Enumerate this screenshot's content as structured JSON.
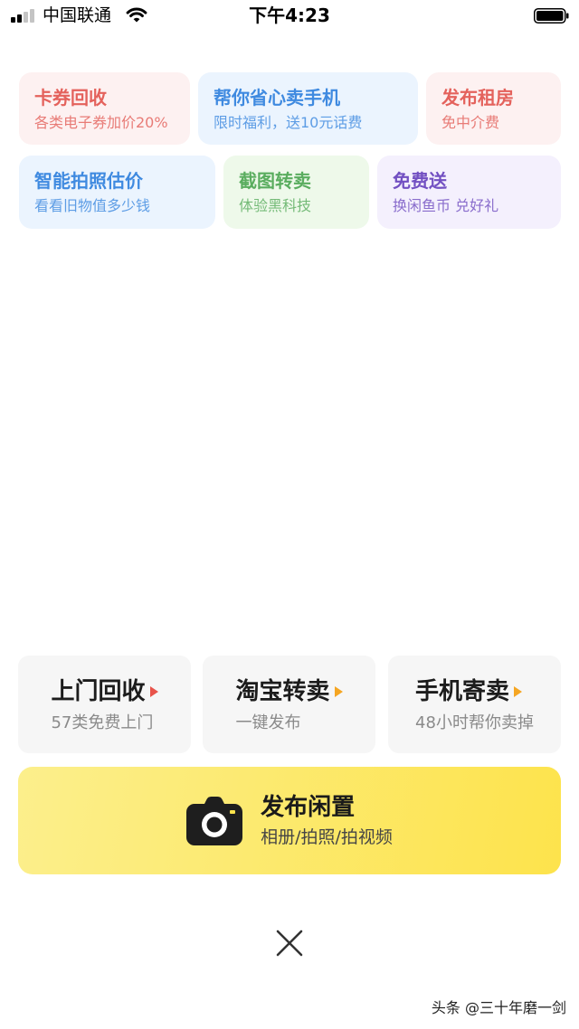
{
  "status_bar": {
    "carrier": "中国联通",
    "time": "下午4:23",
    "icons": {
      "signal": "signal-icon",
      "wifi": "wifi-icon",
      "battery": "battery-icon"
    }
  },
  "quick_actions": [
    {
      "title": "卡券回收",
      "subtitle": "各类电子券加价20%",
      "accent": "#e4625c",
      "bg": "#fdf1f1"
    },
    {
      "title": "帮你省心卖手机",
      "subtitle": "限时福利，送10元话费",
      "accent": "#3f8ae0",
      "bg": "#ebf4fe"
    },
    {
      "title": "发布租房",
      "subtitle": "免中介费",
      "accent": "#e4625c",
      "bg": "#fdf1f1"
    },
    {
      "title": "智能拍照估价",
      "subtitle": "看看旧物值多少钱",
      "accent": "#3f8ae0",
      "bg": "#ebf4fe"
    },
    {
      "title": "截图转卖",
      "subtitle": "体验黑科技",
      "accent": "#5aad5f",
      "bg": "#eef9ea"
    },
    {
      "title": "免费送",
      "subtitle": "换闲鱼币 兑好礼",
      "accent": "#7250c2",
      "bg": "#f4f0fd"
    }
  ],
  "services": [
    {
      "title": "上门回收",
      "subtitle": "57类免费上门",
      "arrow_color": "#e8534a"
    },
    {
      "title": "淘宝转卖",
      "subtitle": "一键发布",
      "arrow_color": "#f5a623"
    },
    {
      "title": "手机寄卖",
      "subtitle": "48小时帮你卖掉",
      "arrow_color": "#f5a623"
    }
  ],
  "publish": {
    "title": "发布闲置",
    "subtitle": "相册/拍照/拍视频",
    "icon": "camera-icon",
    "gradient": [
      "#fcef8c",
      "#fde34c"
    ]
  },
  "close": {
    "icon": "close-icon"
  },
  "watermark": "头条 @三十年磨一剑"
}
